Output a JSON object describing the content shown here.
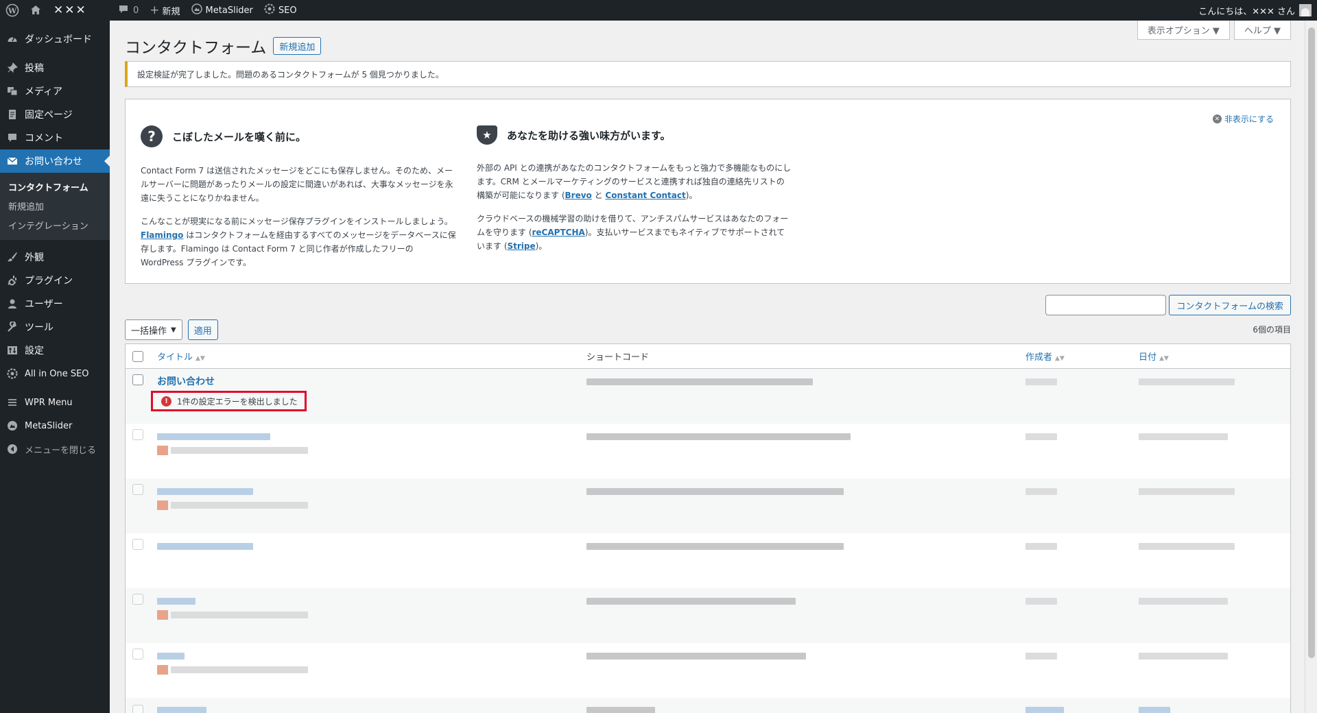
{
  "adminbar": {
    "site_name": "✕✕✕",
    "comments_count": "0",
    "new_label": "新規",
    "metaslider_label": "MetaSlider",
    "seo_label": "SEO",
    "greeting": "こんにちは、✕✕✕ さん"
  },
  "sidebar": {
    "dashboard": "ダッシュボード",
    "posts": "投稿",
    "media": "メディア",
    "pages": "固定ページ",
    "comments": "コメント",
    "contact": "お問い合わせ",
    "contact_sub": [
      "コンタクトフォーム",
      "新規追加",
      "インテグレーション"
    ],
    "appearance": "外観",
    "plugins": "プラグイン",
    "users": "ユーザー",
    "tools": "ツール",
    "settings": "設定",
    "aioseo": "All in One SEO",
    "wpr_menu": "WPR Menu",
    "metaslider": "MetaSlider",
    "collapse": "メニューを閉じる"
  },
  "screen_meta": {
    "options": "表示オプション ▼",
    "help": "ヘルプ ▼"
  },
  "page": {
    "title": "コンタクトフォーム",
    "add_new": "新規追加",
    "notice": "設定検証が完了しました。問題のあるコンタクトフォームが 5 個見つかりました。"
  },
  "welcome": {
    "dismiss": "非表示にする",
    "col1": {
      "title": "こぼしたメールを嘆く前に。",
      "p1": "Contact Form 7 は送信されたメッセージをどこにも保存しません。そのため、メールサーバーに問題があったりメールの設定に間違いがあれば、大事なメッセージを永遠に失うことになりかねません。",
      "p2_a": "こんなことが現実になる前にメッセージ保存プラグインをインストールしましょう。",
      "p2_link": "Flamingo",
      "p2_b": " はコンタクトフォームを経由するすべてのメッセージをデータベースに保存します。Flamingo は Contact Form 7 と同じ作者が作成したフリーの WordPress プラグインです。"
    },
    "col2": {
      "title": "あなたを助ける強い味方がいます。",
      "p1_a": "外部の API との連携があなたのコンタクトフォームをもっと強力で多機能なものにします。CRM とメールマーケティングのサービスと連携すれば独自の連絡先リストの構築が可能になります (",
      "p1_link1": "Brevo",
      "p1_mid": " と ",
      "p1_link2": "Constant Contact",
      "p1_b": ")。",
      "p2_a": "クラウドベースの機械学習の助けを借りて、アンチスパムサービスはあなたのフォームを守ります (",
      "p2_link1": "reCAPTCHA",
      "p2_mid": ")。支払いサービスまでもネイティブでサポートされています (",
      "p2_link2": "Stripe",
      "p2_b": ")。"
    }
  },
  "search": {
    "button": "コンタクトフォームの検索",
    "placeholder": ""
  },
  "bulk": {
    "selected": "一括操作",
    "apply": "適用"
  },
  "items_count": "6個の項目",
  "table": {
    "columns": [
      "タイトル",
      "ショートコード",
      "作成者",
      "日付"
    ],
    "first_row": {
      "title": "お問い合わせ",
      "error": "1件の設定エラーを検出しました"
    }
  }
}
